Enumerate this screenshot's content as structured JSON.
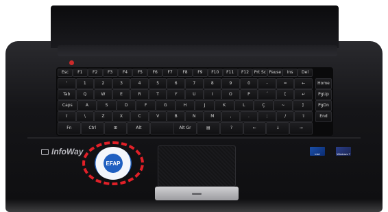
{
  "brand": {
    "name": "InfoWay"
  },
  "badge": {
    "label": "EFAP"
  },
  "keys": {
    "row0": [
      "Esc",
      "F1",
      "F2",
      "F3",
      "F4",
      "F5",
      "F6",
      "F7",
      "F8",
      "F9",
      "F10",
      "F11",
      "F12",
      "Prt Sc",
      "Pause",
      "Ins",
      "Del"
    ],
    "row1": [
      "'",
      "1",
      "2",
      "3",
      "4",
      "5",
      "6",
      "7",
      "8",
      "9",
      "0",
      "-",
      "=",
      "←"
    ],
    "row2": [
      "Tab",
      "Q",
      "W",
      "E",
      "R",
      "T",
      "Y",
      "U",
      "I",
      "O",
      "P",
      "´",
      "[",
      "↵"
    ],
    "row3": [
      "Caps",
      "A",
      "S",
      "D",
      "F",
      "G",
      "H",
      "J",
      "K",
      "L",
      "Ç",
      "~",
      "]"
    ],
    "row4": [
      "⇧",
      "\\",
      "Z",
      "X",
      "C",
      "V",
      "B",
      "N",
      "M",
      ",",
      ".",
      ";",
      "/",
      "⇧"
    ],
    "row5": [
      "Fn",
      "Ctrl",
      "⊞",
      "Alt",
      "",
      "Alt Gr",
      "▤",
      "?",
      "←",
      "↓",
      "→"
    ]
  },
  "side_keys": [
    "Home",
    "PgUp",
    "PgDn",
    "End"
  ],
  "stickers": {
    "intel": "intel",
    "windows": "Windows 7"
  }
}
